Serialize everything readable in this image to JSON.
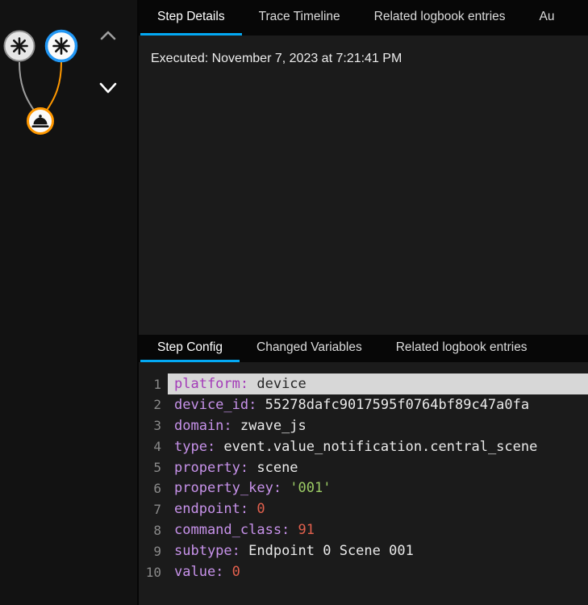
{
  "colors": {
    "accent_tab_underline": "#03a9f4",
    "selected_node_ring": "#2196f3",
    "active_path_orange": "#ff9800"
  },
  "icons": {
    "trigger_node": "asterisk-8-spoke",
    "selected_trigger_node": "asterisk-8-spoke",
    "action_node": "cloche-dome",
    "nav_up": "chevron-up",
    "nav_down": "chevron-down"
  },
  "top_tabs": [
    {
      "id": "step-details",
      "label": "Step Details",
      "active": true
    },
    {
      "id": "trace-timeline",
      "label": "Trace Timeline",
      "active": false
    },
    {
      "id": "related-logbook",
      "label": "Related logbook entries",
      "active": false
    },
    {
      "id": "automation-config",
      "label": "Au",
      "active": false
    }
  ],
  "step_details": {
    "executed": "Executed: November 7, 2023 at 7:21:41 PM"
  },
  "bottom_tabs": [
    {
      "id": "step-config",
      "label": "Step Config",
      "active": true
    },
    {
      "id": "changed-variables",
      "label": "Changed Variables",
      "active": false
    },
    {
      "id": "related-logbook-entries",
      "label": "Related logbook entries",
      "active": false
    }
  ],
  "step_config_code": {
    "language": "yaml",
    "lines": [
      {
        "num": 1,
        "key": "platform",
        "value": "device",
        "kind": "plain",
        "highlighted": true
      },
      {
        "num": 2,
        "key": "device_id",
        "value": "55278dafc9017595f0764bf89c47a0fa",
        "kind": "plain"
      },
      {
        "num": 3,
        "key": "domain",
        "value": "zwave_js",
        "kind": "plain"
      },
      {
        "num": 4,
        "key": "type",
        "value": "event.value_notification.central_scene",
        "kind": "plain"
      },
      {
        "num": 5,
        "key": "property",
        "value": "scene",
        "kind": "plain"
      },
      {
        "num": 6,
        "key": "property_key",
        "value": "'001'",
        "kind": "string"
      },
      {
        "num": 7,
        "key": "endpoint",
        "value": "0",
        "kind": "number"
      },
      {
        "num": 8,
        "key": "command_class",
        "value": "91",
        "kind": "number"
      },
      {
        "num": 9,
        "key": "subtype",
        "value": "Endpoint 0 Scene 001",
        "kind": "plain"
      },
      {
        "num": 10,
        "key": "value",
        "value": "0",
        "kind": "number"
      }
    ]
  }
}
